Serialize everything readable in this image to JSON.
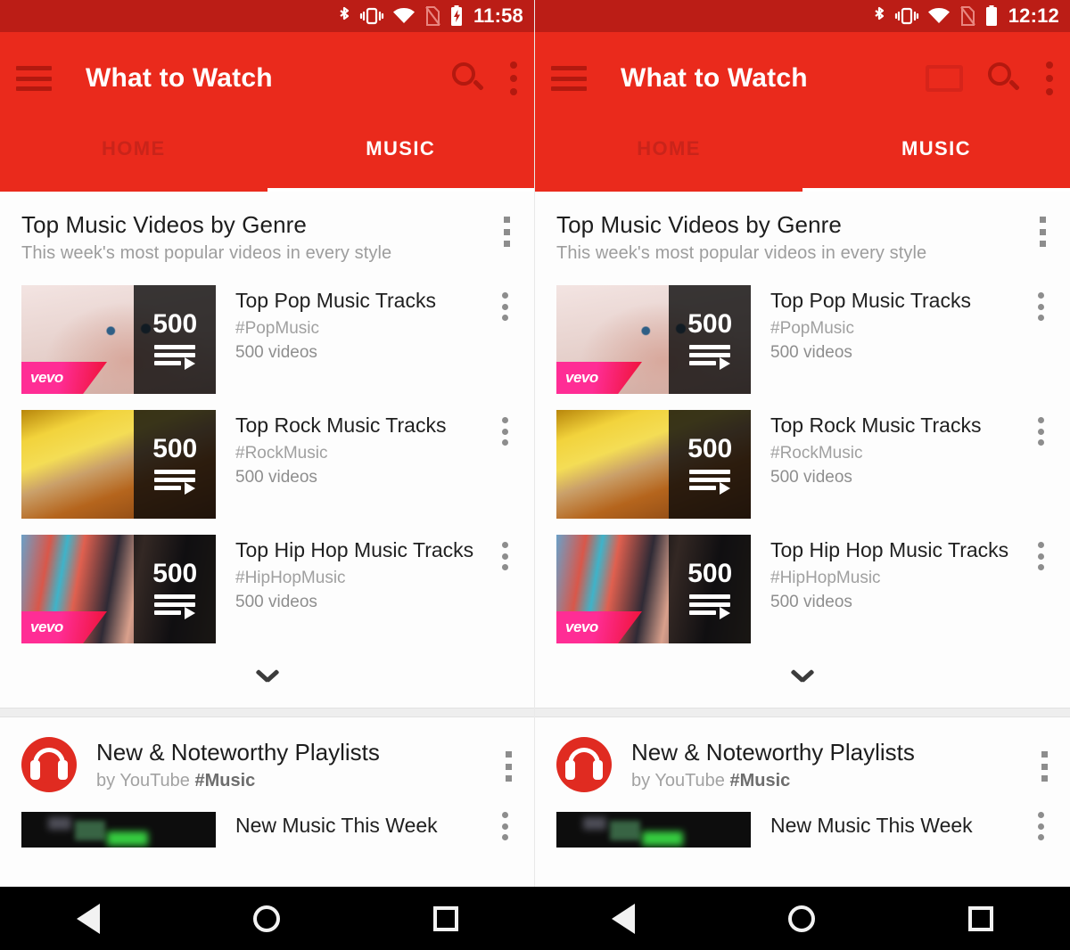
{
  "panels": [
    {
      "status": {
        "time": "11:58",
        "icons": [
          "bluetooth-icon",
          "vibrate-icon",
          "wifi-icon",
          "no-sim-icon",
          "battery-charging-icon"
        ],
        "battery_charging": true
      },
      "toolbar": {
        "menu_label": "menu-icon",
        "title": "What to Watch",
        "has_cast": false,
        "search_label": "search-icon",
        "overflow_label": "more-options"
      },
      "tabs": [
        {
          "label": "HOME",
          "active": false
        },
        {
          "label": "MUSIC",
          "active": true
        }
      ]
    },
    {
      "status": {
        "time": "12:12",
        "icons": [
          "bluetooth-icon",
          "vibrate-icon",
          "wifi-icon",
          "no-sim-icon",
          "battery-icon"
        ],
        "battery_charging": false
      },
      "toolbar": {
        "menu_label": "menu-icon",
        "title": "What to Watch",
        "has_cast": true,
        "cast_label": "cast-icon",
        "search_label": "search-icon",
        "overflow_label": "more-options"
      },
      "tabs": [
        {
          "label": "HOME",
          "active": false
        },
        {
          "label": "MUSIC",
          "active": true
        }
      ]
    }
  ],
  "content": {
    "genre_card": {
      "title": "Top Music Videos by Genre",
      "subtitle": "This week's most popular videos in every style",
      "rows": [
        {
          "title": "Top Pop Music Tracks",
          "tag": "#PopMusic",
          "meta": "500 videos",
          "count": "500",
          "vevo": "vevo",
          "has_vevo": true,
          "thumb_kind": "pop-portrait"
        },
        {
          "title": "Top Rock Music Tracks",
          "tag": "#RockMusic",
          "meta": "500 videos",
          "count": "500",
          "has_vevo": false,
          "thumb_kind": "rock-guitar"
        },
        {
          "title": "Top Hip Hop Music Tracks",
          "tag": "#HipHopMusic",
          "meta": "500 videos",
          "count": "500",
          "vevo": "vevo",
          "has_vevo": true,
          "thumb_kind": "hiphop-headdress"
        }
      ],
      "expand_label": "chevron-down-icon"
    },
    "playlists_card": {
      "title": "New & Noteworthy Playlists",
      "byline_prefix": "by YouTube ",
      "byline_tag": "#Music",
      "rows": [
        {
          "title": "New Music This Week"
        }
      ]
    }
  },
  "navbar": {
    "back_label": "back-button",
    "home_label": "home-button",
    "recents_label": "recents-button"
  },
  "colors": {
    "status_bar": "#bb1d16",
    "toolbar": "#ea2a1c",
    "toolbar_icon": "#b3190f",
    "accent_red": "#e02b21",
    "vevo_pink": "#ff2d95",
    "nav_bar": "#000000"
  }
}
